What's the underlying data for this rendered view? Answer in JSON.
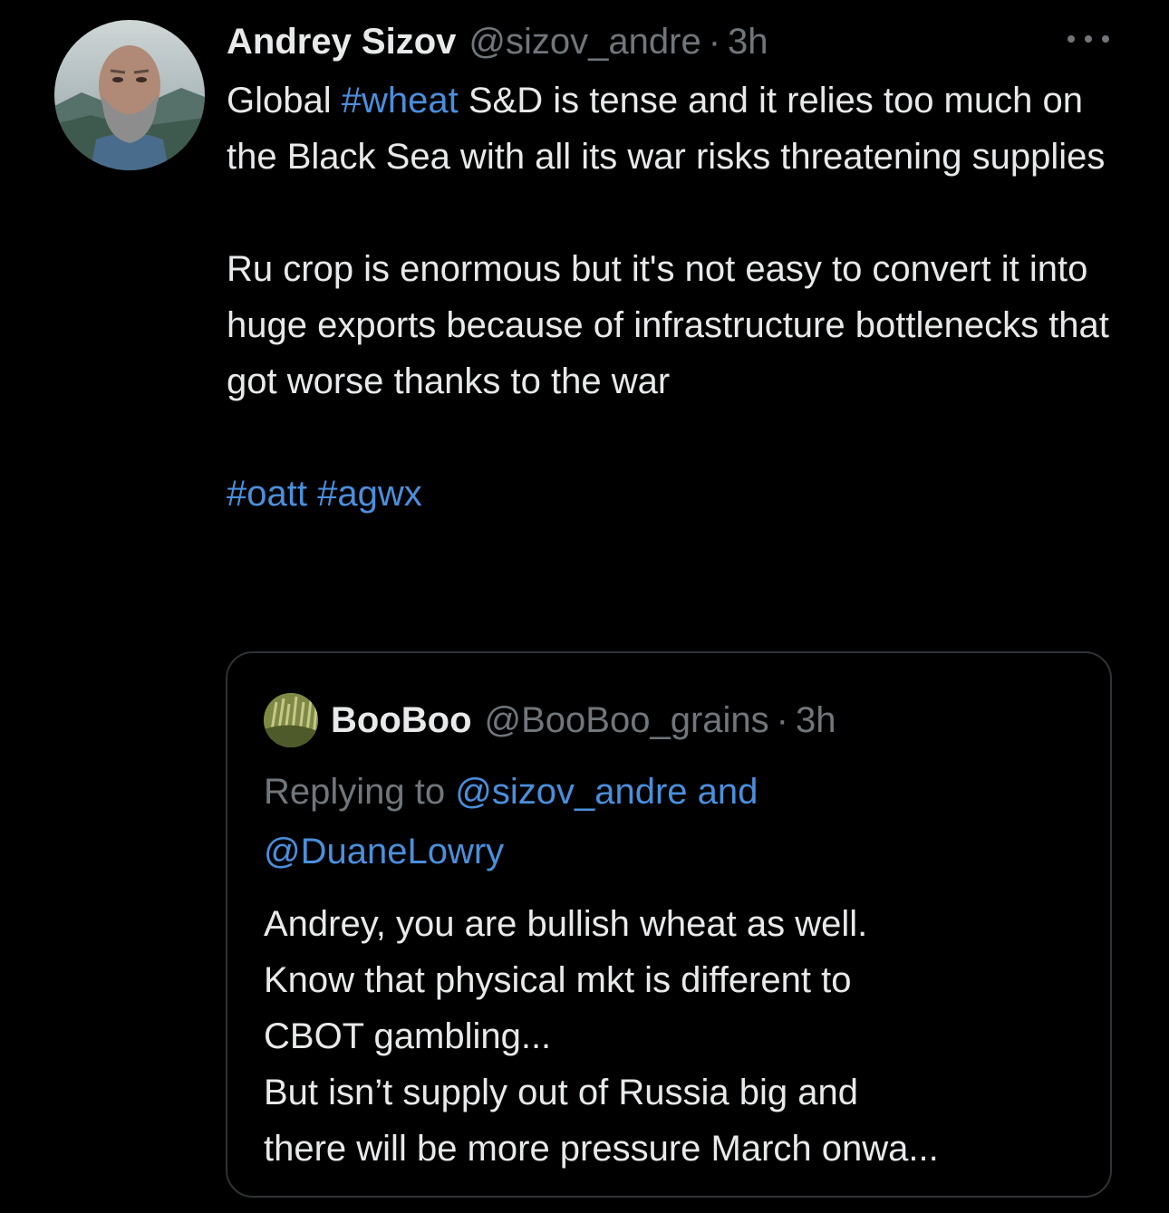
{
  "tweet": {
    "author_name": "Andrey Sizov",
    "author_handle": "@sizov_andre",
    "separator": "·",
    "time": "3h",
    "more_icon": "more-horizontal-icon",
    "body": {
      "line1_prefix": "Global ",
      "line1_hashtag": "#wheat",
      "line1_suffix": " S&D is tense and it relies too much on the Black Sea with all its war risks threatening supplies",
      "para2": "Ru crop is enormous but it's not easy to convert it into huge exports because of infrastructure bottlenecks that got worse thanks to the war",
      "hashtag_oatt": "#oatt",
      "hashtag_agwx": "#agwx"
    }
  },
  "quote": {
    "author_name": "BooBoo",
    "author_handle": "@BooBoo_grains",
    "separator": "·",
    "time": "3h",
    "replying_prefix": "Replying to ",
    "mention1": "@sizov_andre",
    "and_word": " and",
    "mention2": "@DuaneLowry",
    "lines": [
      "Andrey, you are bullish wheat as well.",
      "Know that physical mkt is different to",
      "CBOT gambling...",
      "But isn’t supply out of Russia big and",
      "there will be more pressure March onwa..."
    ]
  },
  "colors": {
    "background": "#000000",
    "text": "#e7e9ea",
    "muted": "#71767b",
    "link": "#4a8fdc",
    "border": "#2f3336"
  }
}
